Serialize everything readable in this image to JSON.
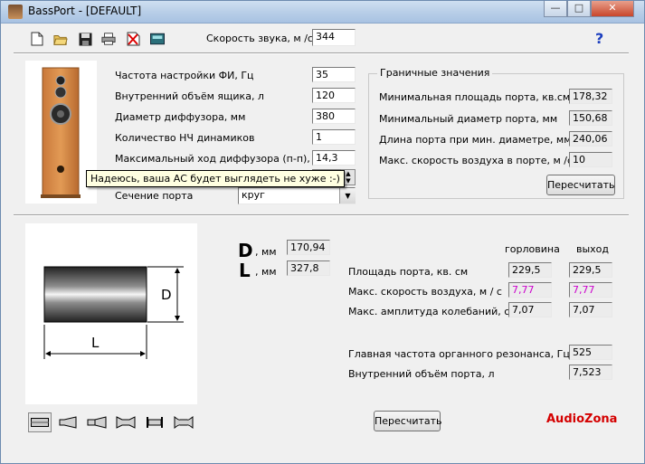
{
  "window": {
    "title": "BassPort - [DEFAULT]",
    "buttons": [
      "—",
      "□",
      "✕"
    ]
  },
  "toolbar": {
    "icons": [
      "new-file-icon",
      "open-folder-icon",
      "save-disk-icon",
      "print-icon",
      "delete-icon",
      "calculator-icon"
    ],
    "sound_speed_label": "Скорость звука, м /с",
    "sound_speed_value": "344",
    "help": "?"
  },
  "params": {
    "tuning_freq_label": "Частота настройки ФИ, Гц",
    "tuning_freq_value": "35",
    "box_volume_label": "Внутренний объём ящика, л",
    "box_volume_value": "120",
    "cone_diameter_label": "Диаметр диффузора, мм",
    "cone_diameter_value": "380",
    "driver_count_label": "Количество НЧ динамиков",
    "driver_count_value": "1",
    "max_excursion_label": "Максимальный ход диффузора (п-п), мм",
    "max_excursion_value": "14,3",
    "port_section_label": "Сечение порта",
    "port_section_value": "круг"
  },
  "tooltip": "Надеюсь, ваша АС будет выглядеть не хуже :-)",
  "limits": {
    "title": "Граничные значения",
    "rows": [
      {
        "label": "Минимальная площадь порта, кв.см.",
        "value": "178,32"
      },
      {
        "label": "Минимальный диаметр порта, мм",
        "value": "150,68"
      },
      {
        "label": "Длина порта при мин. диаметре, мм",
        "value": "240,06"
      },
      {
        "label": "Макс. скорость воздуха в порте, м /с",
        "value": "10"
      }
    ],
    "recalc_label": "Пересчитать"
  },
  "port": {
    "diagram_d": "D",
    "diagram_l": "L",
    "d_letter": "D",
    "d_unit": ", мм",
    "d_value": "170,94",
    "l_letter": "L",
    "l_unit": ", мм",
    "l_value": "327,8",
    "col_throat": "горловина",
    "col_exit": "выход",
    "rows": [
      {
        "label": "Площадь порта, кв. см",
        "throat": "229,5",
        "exit": "229,5"
      },
      {
        "label": "Макс. скорость воздуха, м / с",
        "throat": "7,77",
        "exit": "7,77"
      },
      {
        "label": "Макс. амплитуда колебаний, см",
        "throat": "7,07",
        "exit": "7,07"
      }
    ],
    "resonance_label": "Главная частота органного резонанса, Гц",
    "resonance_value": "525",
    "port_volume_label": "Внутренний объём порта, л",
    "port_volume_value": "7,523",
    "recalc_label": "Пересчитать",
    "velocity_color": "#cc00cc"
  },
  "logo": {
    "part1": "Audio",
    "part2": "Zona",
    "color": "#d40000"
  }
}
